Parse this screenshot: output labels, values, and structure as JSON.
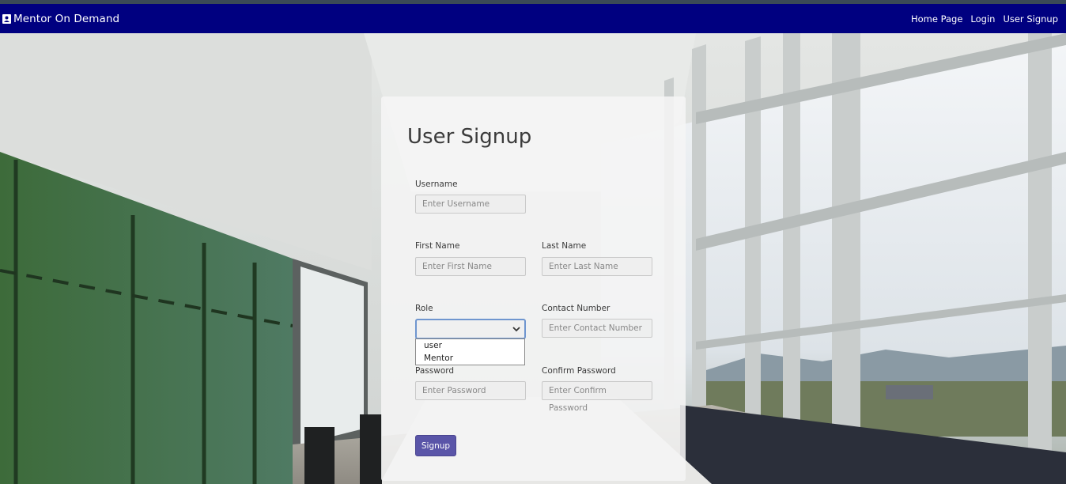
{
  "brand": {
    "title": "Mentor On Demand"
  },
  "nav": {
    "links": [
      "Home Page",
      "Login",
      "User Signup"
    ]
  },
  "form": {
    "title": "User Signup",
    "username": {
      "label": "Username",
      "placeholder": "Enter Username"
    },
    "first_name": {
      "label": "First Name",
      "placeholder": "Enter First Name"
    },
    "last_name": {
      "label": "Last Name",
      "placeholder": "Enter Last Name"
    },
    "role": {
      "label": "Role",
      "value": "",
      "options": [
        "user",
        "Mentor"
      ]
    },
    "contact": {
      "label": "Contact Number",
      "placeholder": "Enter Contact Number"
    },
    "password": {
      "label": "Password",
      "placeholder": "Enter Password"
    },
    "confirm_password": {
      "label": "Confirm Password",
      "placeholder": "Enter Confirm Password"
    },
    "submit_label": "Signup"
  },
  "colors": {
    "navbar": "#000080",
    "button": "#5a55a8"
  }
}
